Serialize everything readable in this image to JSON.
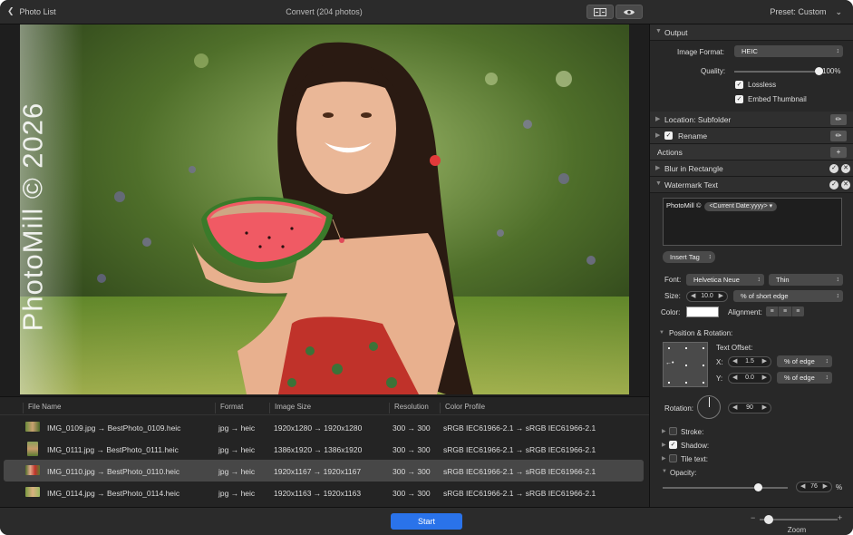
{
  "topbar": {
    "back_label": "Photo List",
    "title": "Convert (204 photos)",
    "preset_label": "Preset: Custom"
  },
  "watermark_text": "PhotoMill © 2026",
  "table": {
    "headers": [
      "File Name",
      "Format",
      "Image Size",
      "Resolution",
      "Color Profile"
    ],
    "rows": [
      {
        "file": "IMG_0109.jpg → BestPhoto_0109.heic",
        "format": "jpg → heic",
        "size": "1920x1280 → 1920x1280",
        "resolution": "300 → 300",
        "profile": "sRGB IEC61966-2.1 → sRGB IEC61966-2.1",
        "selected": false
      },
      {
        "file": "IMG_0111.jpg → BestPhoto_0111.heic",
        "format": "jpg → heic",
        "size": "1386x1920 → 1386x1920",
        "resolution": "300 → 300",
        "profile": "sRGB IEC61966-2.1 → sRGB IEC61966-2.1",
        "selected": false
      },
      {
        "file": "IMG_0110.jpg → BestPhoto_0110.heic",
        "format": "jpg → heic",
        "size": "1920x1167 → 1920x1167",
        "resolution": "300 → 300",
        "profile": "sRGB IEC61966-2.1 → sRGB IEC61966-2.1",
        "selected": true
      },
      {
        "file": "IMG_0114.jpg → BestPhoto_0114.heic",
        "format": "jpg → heic",
        "size": "1920x1163 → 1920x1163",
        "resolution": "300 → 300",
        "profile": "sRGB IEC61966-2.1 → sRGB IEC61966-2.1",
        "selected": false
      }
    ]
  },
  "bottombar": {
    "start_label": "Start",
    "zoom_label": "Zoom",
    "zoom_minus": "−",
    "zoom_plus": "+",
    "zoom_level": 0.1
  },
  "sidebar": {
    "output": {
      "header": "Output",
      "format_label": "Image Format:",
      "format_value": "HEIC",
      "quality_label": "Quality:",
      "quality_value": "100%",
      "quality_level": 1.0,
      "lossless_label": "Lossless",
      "lossless_checked": true,
      "embed_label": "Embed Thumbnail",
      "embed_checked": true
    },
    "location_label": "Location: Subfolder",
    "rename_label": "Rename",
    "actions_label": "Actions",
    "blur_label": "Blur in Rectangle",
    "watermark": {
      "header": "Watermark Text",
      "text": "PhotoMill ©",
      "token": "<Current Date:yyyy>",
      "insert_tag": "Insert Tag",
      "font_label": "Font:",
      "font_family": "Helvetica Neue",
      "font_weight": "Thin",
      "size_label": "Size:",
      "size_value": "10.0",
      "size_unit": "% of short edge",
      "color_label": "Color:",
      "color_value": "#ffffff",
      "alignment_label": "Alignment:",
      "pos_header": "Position & Rotation:",
      "text_offset_label": "Text Offset:",
      "x_label": "X:",
      "x_value": "1.5",
      "x_unit": "% of edge",
      "y_label": "Y:",
      "y_value": "0.0",
      "y_unit": "% of edge",
      "rotation_label": "Rotation:",
      "rotation_value": "90",
      "stroke_label": "Stroke:",
      "shadow_label": "Shadow:",
      "tile_label": "Tile text:",
      "opacity_label": "Opacity:",
      "opacity_value": "76",
      "opacity_unit": "%",
      "opacity_level": 0.76
    }
  },
  "colors": {
    "accent": "#2a73ea",
    "panel": "#282828",
    "selected_row": "#474747"
  }
}
